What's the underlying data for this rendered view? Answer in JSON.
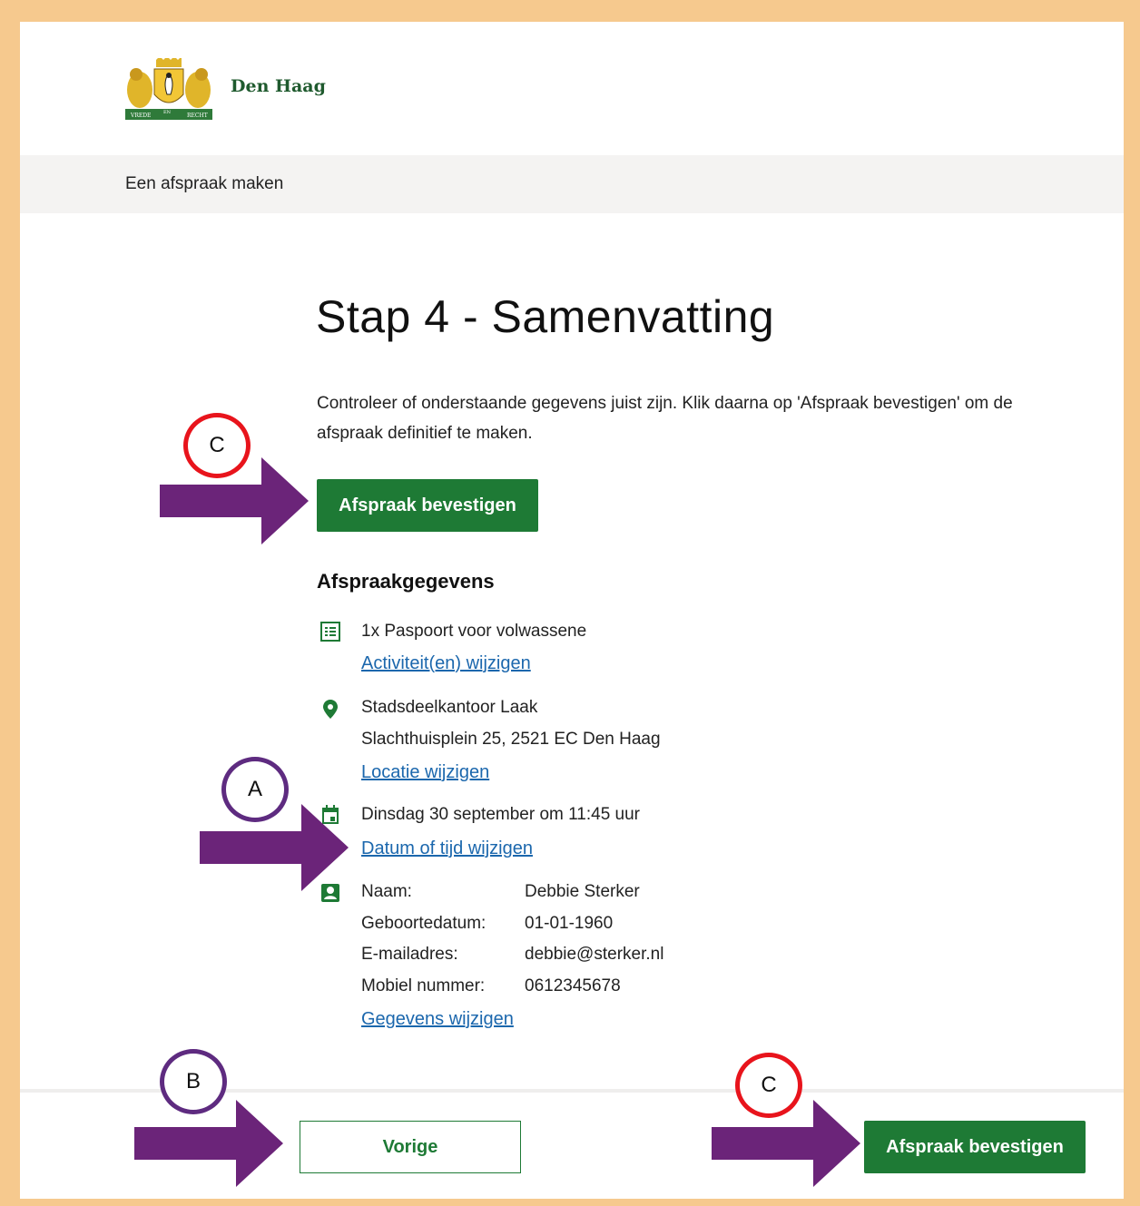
{
  "header": {
    "brand": "Den Haag",
    "logo_banner": [
      "VREDE",
      "EN",
      "RECHT"
    ],
    "subtitle": "Een afspraak maken"
  },
  "main": {
    "title": "Stap 4 - Samenvatting",
    "intro": "Controleer of onderstaande gegevens juist zijn. Klik daarna op 'Afspraak bevestigen' om de afspraak definitief te maken.",
    "confirm_label": "Afspraak bevestigen",
    "section_title": "Afspraakgegevens",
    "activity": {
      "icon": "list-icon",
      "text": "1x  Paspoort voor volwassene",
      "link": "Activiteit(en) wijzigen"
    },
    "location": {
      "icon": "map-pin-icon",
      "name": "Stadsdeelkantoor Laak",
      "address": "Slachthuisplein 25, 2521 EC Den Haag",
      "link": "Locatie wijzigen"
    },
    "datetime": {
      "icon": "calendar-icon",
      "text": "Dinsdag 30 september om 11:45 uur",
      "link": "Datum of tijd wijzigen"
    },
    "person": {
      "icon": "contact-card-icon",
      "fields": [
        {
          "label": "Naam:",
          "value": "Debbie Sterker"
        },
        {
          "label": "Geboortedatum:",
          "value": "01-01-1960"
        },
        {
          "label": "E-mailadres:",
          "value": "debbie@sterker.nl"
        },
        {
          "label": "Mobiel nummer:",
          "value": "0612345678"
        }
      ],
      "link": "Gegevens wijzigen"
    }
  },
  "footer": {
    "previous_label": "Vorige",
    "confirm_label": "Afspraak bevestigen"
  },
  "annotations": {
    "c_top": "C",
    "a": "A",
    "b": "B",
    "c_bottom": "C",
    "arrow_color": "#6b2479",
    "red_circle_color": "#e8141c",
    "purple_circle_color": "#5e2b80"
  },
  "colors": {
    "background_frame": "#f6c98e",
    "primary_green": "#1e7a35",
    "link_blue": "#1b67ad",
    "brand_green": "#1f5a2e"
  }
}
